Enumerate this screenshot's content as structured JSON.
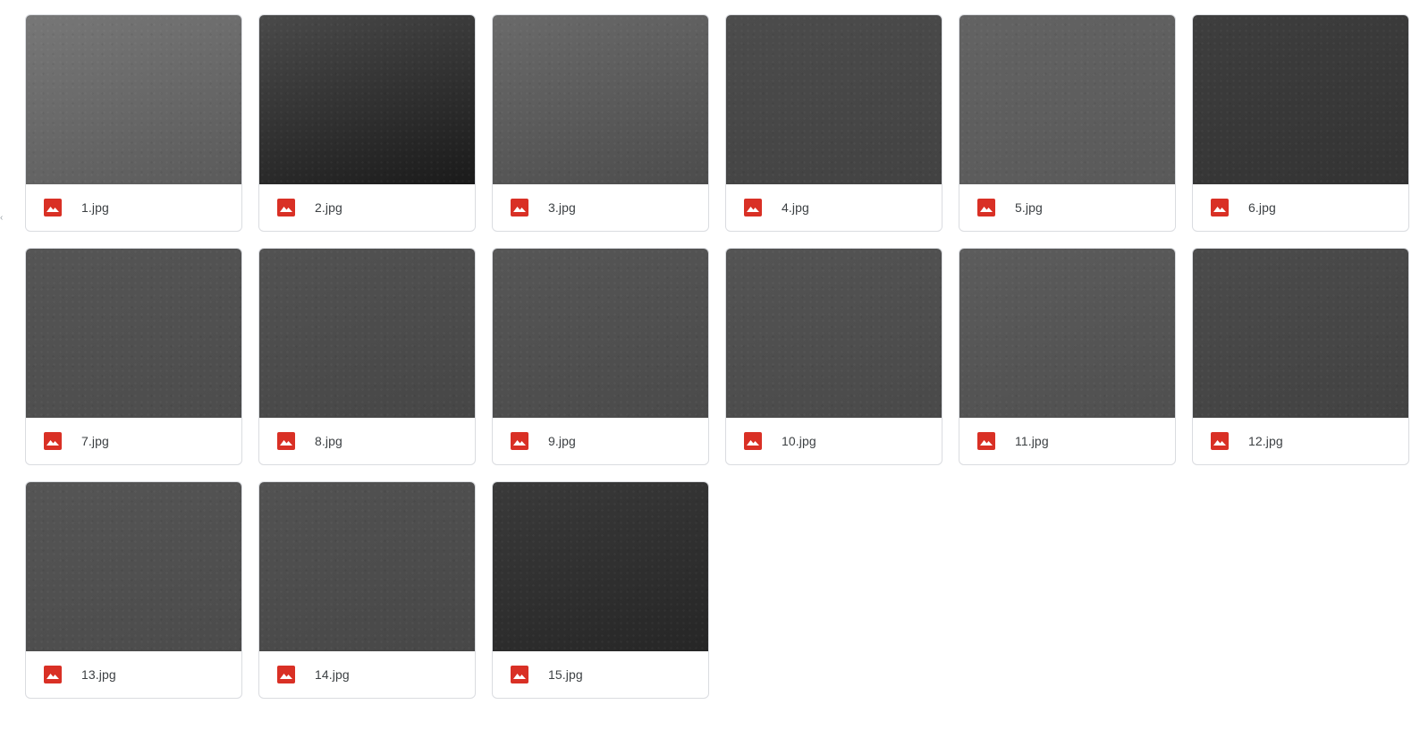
{
  "file_icon": "image-file-icon",
  "icon_color": "#d93025",
  "files": [
    {
      "name": "1.jpg",
      "thumb": [
        "#777777",
        "#5a5a5a"
      ]
    },
    {
      "name": "2.jpg",
      "thumb": [
        "#4a4a4a",
        "#1a1a1a"
      ]
    },
    {
      "name": "3.jpg",
      "thumb": [
        "#6a6a6a",
        "#4c4c4c"
      ]
    },
    {
      "name": "4.jpg",
      "thumb": [
        "#4c4c4c",
        "#424242"
      ]
    },
    {
      "name": "5.jpg",
      "thumb": [
        "#636363",
        "#595959"
      ]
    },
    {
      "name": "6.jpg",
      "thumb": [
        "#3e3e3e",
        "#333333"
      ]
    },
    {
      "name": "7.jpg",
      "thumb": [
        "#555555",
        "#4c4c4c"
      ]
    },
    {
      "name": "8.jpg",
      "thumb": [
        "#525252",
        "#464646"
      ]
    },
    {
      "name": "9.jpg",
      "thumb": [
        "#565656",
        "#4a4a4a"
      ]
    },
    {
      "name": "10.jpg",
      "thumb": [
        "#545454",
        "#494949"
      ]
    },
    {
      "name": "11.jpg",
      "thumb": [
        "#5c5c5c",
        "#4f4f4f"
      ]
    },
    {
      "name": "12.jpg",
      "thumb": [
        "#4b4b4b",
        "#424242"
      ]
    },
    {
      "name": "13.jpg",
      "thumb": [
        "#555555",
        "#4b4b4b"
      ]
    },
    {
      "name": "14.jpg",
      "thumb": [
        "#525252",
        "#474747"
      ]
    },
    {
      "name": "15.jpg",
      "thumb": [
        "#3a3a3a",
        "#262626"
      ]
    }
  ]
}
